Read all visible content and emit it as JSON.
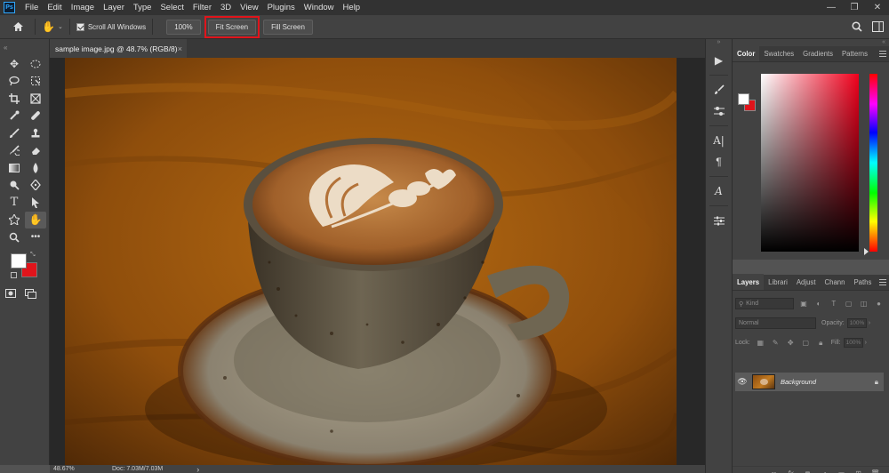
{
  "app": {
    "logo": "Ps"
  },
  "menubar": {
    "items": [
      "File",
      "Edit",
      "Image",
      "Layer",
      "Type",
      "Select",
      "Filter",
      "3D",
      "View",
      "Plugins",
      "Window",
      "Help"
    ],
    "window_controls": [
      "—",
      "❐",
      "✕"
    ]
  },
  "options": {
    "scroll_all_label": "Scroll All Windows",
    "zoom_100_label": "100%",
    "fit_screen_label": "Fit Screen",
    "fill_screen_label": "Fill Screen",
    "fit_highlight_color": "#e0141b"
  },
  "document": {
    "tab_title": "sample image.jpg @ 48.7% (RGB/8)",
    "close_glyph": "×"
  },
  "statusbar": {
    "zoom": "48.67%",
    "doc_info": "Doc: 7.03M/7.03M",
    "arrow": "›"
  },
  "color_panel": {
    "tabs": [
      "Color",
      "Swatches",
      "Gradients",
      "Patterns"
    ],
    "foreground": "#ffffff",
    "background": "#e0141b"
  },
  "layers_panel": {
    "tabs": [
      "Layers",
      "Librari",
      "Adjust",
      "Chann",
      "Paths"
    ],
    "filter_placeholder": "Kind",
    "blend_mode": "Normal",
    "opacity_label": "Opacity:",
    "opacity_value": "100%",
    "lock_label": "Lock:",
    "fill_label": "Fill:",
    "fill_value": "100%",
    "layers": [
      {
        "name": "Background",
        "visible": true,
        "locked": true
      }
    ]
  }
}
